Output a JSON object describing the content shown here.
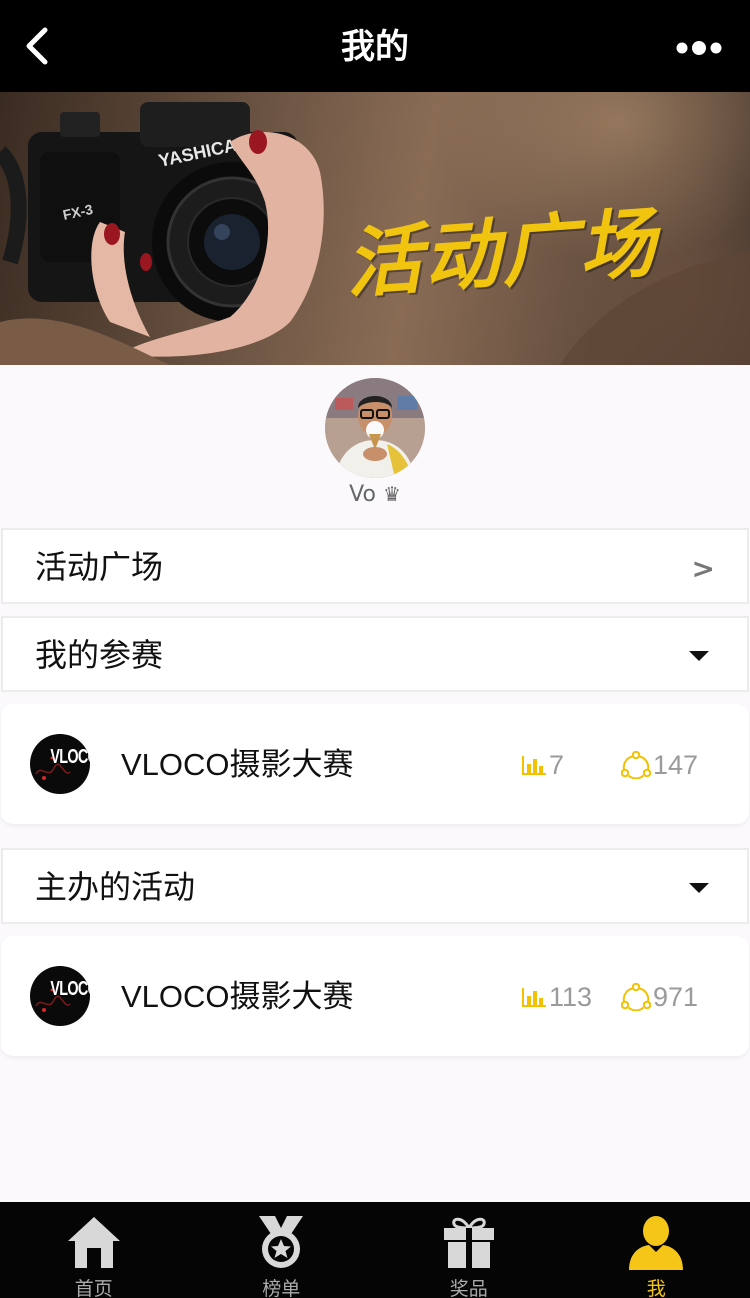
{
  "nav": {
    "title": "我的",
    "back_icon": "chevron-left-icon",
    "more_icon": "more-dots-icon"
  },
  "banner": {
    "title": "活动广场"
  },
  "profile": {
    "username": "Vo",
    "badge": "♛"
  },
  "rows": {
    "activity_plaza": {
      "label": "活动广场",
      "chevron": ">"
    },
    "my_entries": {
      "label": "我的参赛"
    },
    "organized": {
      "label": "主办的活动"
    }
  },
  "my_entries": [
    {
      "logo_text": "VLOCO",
      "name": "VLOCO摄影大赛",
      "rank": "7",
      "participants": "147"
    }
  ],
  "organized": [
    {
      "logo_text": "VLOCO",
      "name": "VLOCO摄影大赛",
      "rank": "113",
      "participants": "971"
    }
  ],
  "tabs": [
    {
      "label": "首页",
      "icon": "home-icon",
      "active": false
    },
    {
      "label": "榜单",
      "icon": "medal-icon",
      "active": false
    },
    {
      "label": "奖品",
      "icon": "gift-icon",
      "active": false
    },
    {
      "label": "我",
      "icon": "user-icon",
      "active": true
    }
  ],
  "colors": {
    "accent": "#f5c518",
    "stat_icon": "#f2c200",
    "nav_bg": "#000000"
  }
}
